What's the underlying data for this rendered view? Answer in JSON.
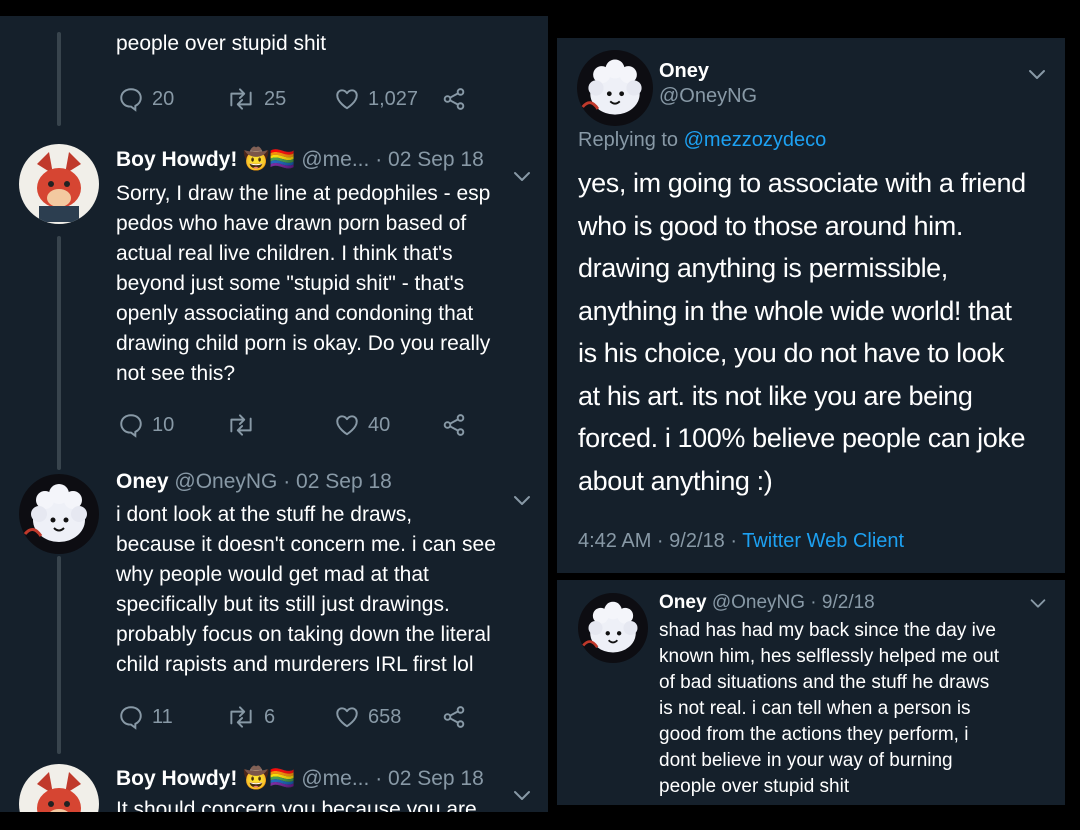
{
  "left_panel": {
    "tweet0": {
      "text_tail": "people over stupid shit",
      "replies": "20",
      "retweets": "25",
      "likes": "1,027"
    },
    "tweet1": {
      "name": "Boy Howdy!",
      "handle": "@me...",
      "date": "· 02 Sep 18",
      "lines": [
        "Sorry, I draw the line at pedophiles - esp",
        "pedos who have drawn porn based of",
        "actual real live children. I think that's",
        "beyond just some \"stupid shit\" - that's",
        "openly associating and condoning that",
        "drawing child porn is okay. Do you really",
        "not see this?"
      ],
      "replies": "10",
      "retweets": "",
      "likes": "40"
    },
    "tweet2": {
      "name": "Oney",
      "handle": "@OneyNG",
      "date": "· 02 Sep 18",
      "lines": [
        "i dont look at the stuff he draws,",
        "because it doesn't concern me. i can see",
        "why people would get mad at that",
        "specifically but its still just drawings.",
        "probably focus on taking down the literal",
        "child rapists and murderers IRL first lol"
      ],
      "replies": "11",
      "retweets": "6",
      "likes": "658"
    },
    "tweet3": {
      "name": "Boy Howdy!",
      "handle": "@me...",
      "date": "· 02 Sep 18",
      "text_partial": "It should concern you because you are"
    },
    "emojis": [
      "🤠",
      "🏳️‍🌈"
    ]
  },
  "right_top": {
    "name": "Oney",
    "handle": "@OneyNG",
    "replying_label": "Replying to",
    "replying_handle": "@mezzozydeco",
    "lines": [
      "yes, im going to associate with a friend",
      "who is good to those around him.",
      "drawing anything is permissible,",
      "anything in the whole wide world! that",
      "is his choice, you do not have to look",
      "at his art. its not like you are being",
      "forced. i 100% believe people can joke",
      "about anything :)"
    ],
    "timestamp": "4:42 AM · 9/2/18 ·",
    "client": "Twitter Web Client"
  },
  "right_bottom": {
    "name": "Oney",
    "handle": "@OneyNG",
    "date": "· 9/2/18",
    "lines": [
      "shad has had my back since the day ive",
      "known him, hes selflessly helped me out",
      "of bad situations and the stuff he draws",
      "is not real. i can tell when a person is",
      "good from the actions they perform, i",
      "dont believe in your way of burning",
      "people over stupid shit"
    ]
  },
  "colors": {
    "background": "#15202b",
    "muted": "#8899a6",
    "link": "#1da1f2",
    "text": "#ffffff"
  }
}
